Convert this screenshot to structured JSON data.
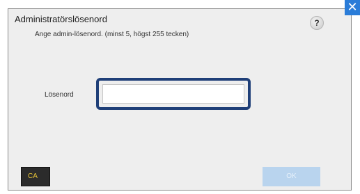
{
  "dialog": {
    "title": "Administratörslösenord",
    "subtitle": "Ange admin-lösenord. (minst 5, högst 255 tecken)",
    "help_label": "?",
    "close_label": "✕"
  },
  "form": {
    "password_label": "Lösenord",
    "password_value": "",
    "password_placeholder": ""
  },
  "buttons": {
    "ca_label": "CA",
    "ok_label": "OK"
  },
  "colors": {
    "accent": "#2a7cd8",
    "focus_ring": "#1f3f78",
    "ca_text": "#e8c437",
    "ok_disabled_bg": "#b9d4ee"
  }
}
